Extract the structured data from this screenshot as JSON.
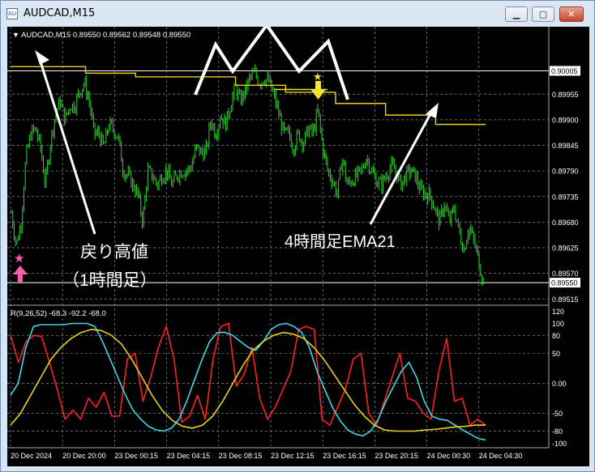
{
  "window": {
    "title": "AUDCAD,M15",
    "icon_label": "AU"
  },
  "window_buttons": {
    "minimize": "▁",
    "maximize": "▢",
    "close": "✕"
  },
  "chart_header": {
    "symbol_info": "AUDCAD,M15  0.89550 0.89562 0.89548 0.89550"
  },
  "indicator_header": "R(9,26,52) -68.3 -92.2 -68.0",
  "annotations": {
    "pullback_high_line1": "戻り高値",
    "pullback_high_line2": "（1時間足）",
    "ema_label": "4時間足EMA21"
  },
  "colors": {
    "background": "#000000",
    "candles": "#2fd32f",
    "ema_line": "#e6d21e",
    "pullback_line": "#f2e52a",
    "osc_red": "#ff2020",
    "osc_cyan": "#3fd6e8",
    "osc_yellow": "#e6d21e",
    "star_pink": "#ff5fa8",
    "grid": "#7f8e9a"
  },
  "chart_data": [
    {
      "type": "candlestick",
      "title": "AUDCAD,M15",
      "y_ticks": [
        "0.90005",
        "0.89955",
        "0.89900",
        "0.89845",
        "0.89790",
        "0.89735",
        "0.89680",
        "0.89625",
        "0.89570",
        "0.89515"
      ],
      "price_labels": {
        "top_line": "0.90005",
        "current": "0.89550"
      },
      "ylim": [
        0.89505,
        0.90065
      ],
      "close_series": [
        0.897,
        0.8963,
        0.8968,
        0.8982,
        0.8987,
        0.8988,
        0.8984,
        0.8976,
        0.8985,
        0.8991,
        0.8994,
        0.899,
        0.8993,
        0.8993,
        0.8996,
        0.8998,
        0.8994,
        0.8987,
        0.8987,
        0.8984,
        0.8989,
        0.8988,
        0.8986,
        0.8979,
        0.8978,
        0.8976,
        0.8974,
        0.8968,
        0.8979,
        0.8978,
        0.8976,
        0.8978,
        0.8979,
        0.8976,
        0.8978,
        0.8979,
        0.8979,
        0.898,
        0.8984,
        0.8983,
        0.8983,
        0.899,
        0.8987,
        0.8991,
        0.8989,
        0.8993,
        0.8997,
        0.8994,
        0.8996,
        0.8999,
        0.9,
        0.8998,
        0.8999,
        0.8998,
        0.8995,
        0.8991,
        0.8987,
        0.8987,
        0.8984,
        0.8987,
        0.8985,
        0.8988,
        0.8987,
        0.8992,
        0.8984,
        0.8979,
        0.8977,
        0.8974,
        0.8982,
        0.8976,
        0.8977,
        0.8978,
        0.8979,
        0.8982,
        0.8979,
        0.8977,
        0.8976,
        0.8978,
        0.898,
        0.8979,
        0.8976,
        0.8978,
        0.8979,
        0.8978,
        0.8975,
        0.8974,
        0.8974,
        0.8971,
        0.8968,
        0.8972,
        0.8968,
        0.8971,
        0.8966,
        0.8962,
        0.8967,
        0.8964,
        0.896,
        0.8955
      ],
      "ema_h4": [
        0.90014,
        0.90014,
        0.90014,
        0.9,
        0.9,
        0.89992,
        0.89992,
        0.89992,
        0.89992,
        0.89974,
        0.89974,
        0.89959,
        0.89959,
        0.89935,
        0.89935,
        0.8991,
        0.8991,
        0.8989,
        0.8989
      ],
      "pullback_high_h1": [
        0.89965,
        0.89965,
        0.89965,
        0.89965,
        0.89965,
        0.89965,
        0.89965,
        0.89965
      ],
      "x_labels": [
        "20 Dec 2024",
        "20 Dec 20:00",
        "23 Dec 00:15",
        "23 Dec 04:15",
        "23 Dec 08:15",
        "23 Dec 12:15",
        "23 Dec 16:15",
        "23 Dec 20:15",
        "24 Dec 00:30",
        "24 Dec 04:30"
      ]
    },
    {
      "type": "line",
      "title": "R(9,26,52) -68.3 -92.2 -68.0",
      "ylim": [
        -105,
        125
      ],
      "y_ticks": [
        "120",
        "100",
        "80",
        "50",
        "0.00",
        "-50",
        "-80",
        "-100"
      ],
      "series": [
        {
          "name": "",
          "color": "#ff2020",
          "values": [
            80,
            35,
            70,
            80,
            78,
            35,
            -10,
            -60,
            -45,
            -60,
            -25,
            -40,
            -15,
            -55,
            -55,
            40,
            50,
            -30,
            10,
            60,
            95,
            40,
            -65,
            -55,
            -20,
            -60,
            40,
            95,
            100,
            -5,
            15,
            60,
            -25,
            -60,
            -40,
            -10,
            20,
            90,
            95,
            90,
            -60,
            -70,
            -40,
            -10,
            40,
            50,
            -50,
            -70,
            -30,
            10,
            50,
            -25,
            -30,
            -50,
            -60,
            20,
            75,
            -30,
            -25,
            -70,
            -60,
            -70
          ]
        },
        {
          "name": "",
          "color": "#3fd6e8",
          "values": [
            -20,
            0,
            60,
            95,
            98,
            98,
            98,
            98,
            100,
            100,
            100,
            95,
            70,
            40,
            10,
            -20,
            -45,
            -60,
            -72,
            -78,
            -80,
            -75,
            -60,
            -30,
            5,
            40,
            70,
            85,
            85,
            80,
            70,
            60,
            55,
            70,
            90,
            98,
            100,
            95,
            85,
            60,
            20,
            -10,
            -40,
            -62,
            -78,
            -85,
            -88,
            -80,
            -60,
            -30,
            -5,
            20,
            35,
            10,
            -30,
            -55,
            -60,
            -62,
            -70,
            -78,
            -85,
            -92,
            -95
          ]
        },
        {
          "name": "",
          "color": "#e6d21e",
          "values": [
            -70,
            -50,
            -20,
            10,
            40,
            60,
            75,
            85,
            90,
            88,
            80,
            65,
            40,
            10,
            -20,
            -45,
            -62,
            -72,
            -75,
            -70,
            -55,
            -30,
            0,
            30,
            55,
            70,
            80,
            85,
            82,
            75,
            60,
            40,
            15,
            -10,
            -35,
            -55,
            -70,
            -78,
            -80,
            -80,
            -80,
            -78,
            -77,
            -75,
            -73,
            -72,
            -70,
            -70
          ]
        }
      ]
    }
  ]
}
